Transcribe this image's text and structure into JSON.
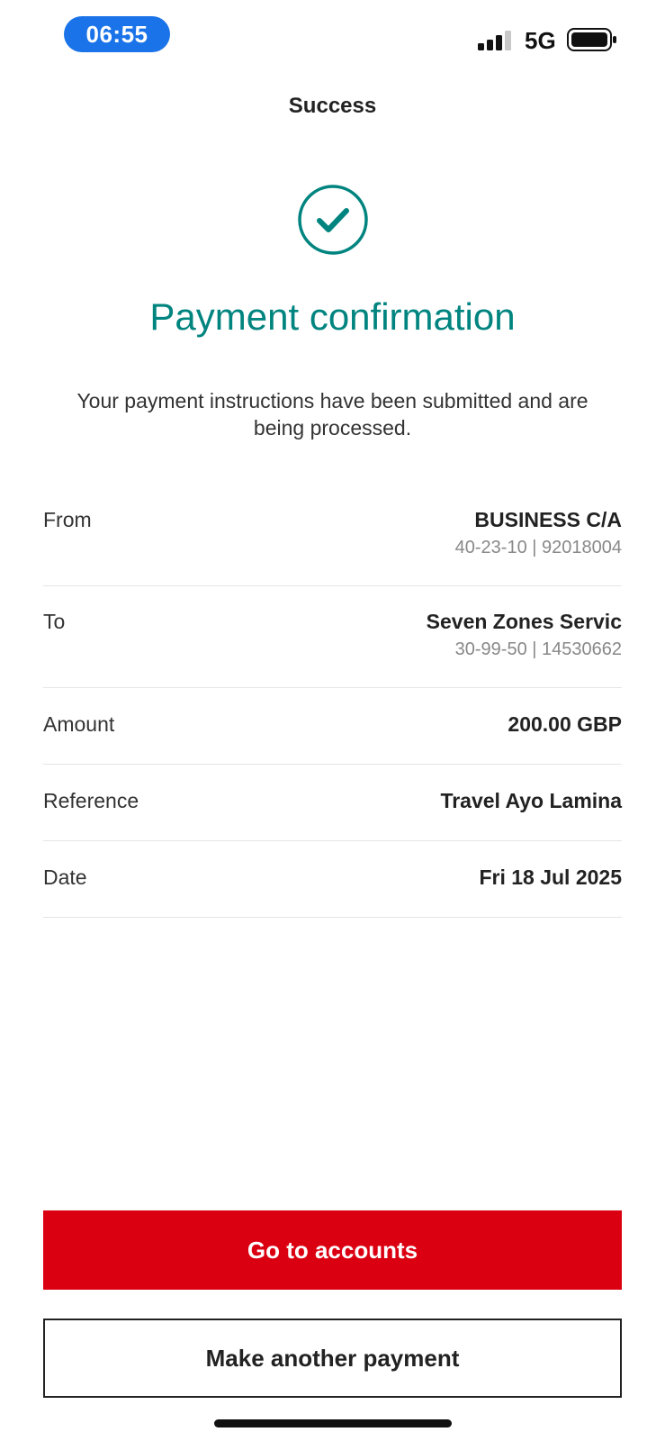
{
  "status_bar": {
    "time": "06:55",
    "network": "5G",
    "icons": [
      "signal-icon",
      "battery-icon"
    ]
  },
  "header": {
    "title": "Success"
  },
  "confirmation": {
    "icon": "check-circle-icon",
    "title": "Payment confirmation",
    "message": "Your payment instructions have been submitted and are being processed."
  },
  "details": {
    "from": {
      "label": "From",
      "value": "BUSINESS C/A",
      "sub": "40-23-10 | 92018004"
    },
    "to": {
      "label": "To",
      "value": "Seven Zones Servic",
      "sub": "30-99-50 | 14530662"
    },
    "amount": {
      "label": "Amount",
      "value": "200.00 GBP"
    },
    "reference": {
      "label": "Reference",
      "value": "Travel Ayo Lamina"
    },
    "date": {
      "label": "Date",
      "value": "Fri 18 Jul 2025"
    }
  },
  "actions": {
    "primary_label": "Go to accounts",
    "secondary_label": "Make another payment"
  },
  "colors": {
    "accent_teal": "#00847f",
    "primary_red": "#db0011",
    "time_pill_blue": "#1a73e8"
  }
}
